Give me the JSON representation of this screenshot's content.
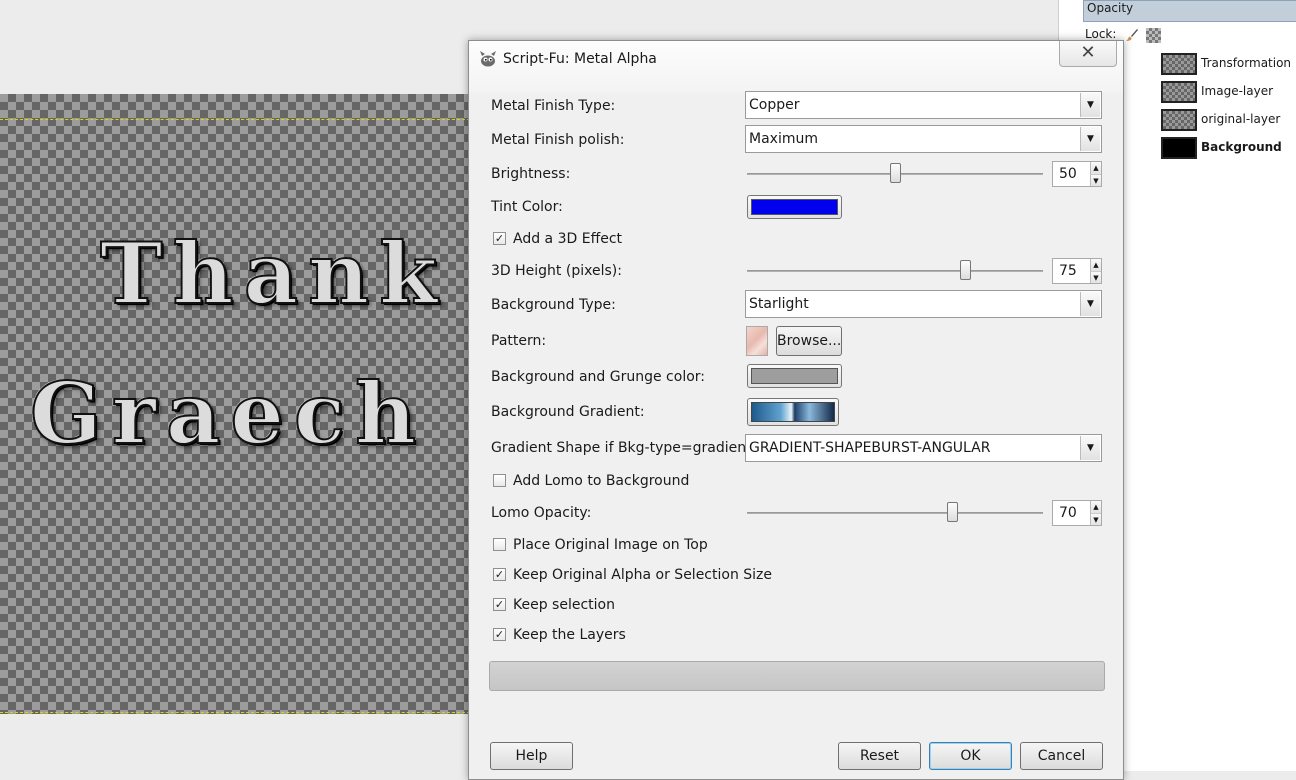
{
  "canvas": {
    "text_line1": "Thank",
    "text_line2": "Graech"
  },
  "layers_panel": {
    "opacity_label": "Opacity",
    "lock_label": "Lock:",
    "layers": [
      {
        "name": "Transformation"
      },
      {
        "name": "Image-layer"
      },
      {
        "name": "original-layer"
      },
      {
        "name": "Background"
      }
    ]
  },
  "dialog": {
    "title": "Script-Fu: Metal Alpha",
    "close_glyph": "✕",
    "fields": {
      "metal_finish_type": {
        "label": "Metal Finish Type:",
        "value": "Copper"
      },
      "metal_finish_polish": {
        "label": "Metal Finish polish:",
        "value": "Maximum"
      },
      "brightness": {
        "label": "Brightness:",
        "value": "50"
      },
      "tint_color": {
        "label": "Tint Color:",
        "color": "#0000ee"
      },
      "add_3d": {
        "label": "Add a 3D Effect",
        "checked": true
      },
      "height_3d": {
        "label": "3D Height (pixels):",
        "value": "75"
      },
      "background_type": {
        "label": "Background Type:",
        "value": "Starlight"
      },
      "pattern": {
        "label": "Pattern:",
        "browse_label": "Browse..."
      },
      "grunge_color": {
        "label": "Background and Grunge color:",
        "color": "#9e9e9e"
      },
      "background_gradient": {
        "label": "Background Gradient:"
      },
      "gradient_shape": {
        "label": "Gradient Shape if Bkg-type=gradient:",
        "value": "GRADIENT-SHAPEBURST-ANGULAR"
      },
      "add_lomo": {
        "label": "Add Lomo to Background",
        "checked": false
      },
      "lomo_opacity": {
        "label": "Lomo Opacity:",
        "value": "70"
      },
      "place_original": {
        "label": "Place Original Image on Top",
        "checked": false
      },
      "keep_alpha": {
        "label": "Keep Original Alpha or Selection Size",
        "checked": true
      },
      "keep_selection": {
        "label": "Keep selection",
        "checked": true
      },
      "keep_layers": {
        "label": "Keep the Layers",
        "checked": true
      }
    },
    "buttons": {
      "help": "Help",
      "reset": "Reset",
      "ok": "OK",
      "cancel": "Cancel"
    },
    "check_glyph": "✓",
    "dropdown_glyph": "▼",
    "spin_up_glyph": "▲",
    "spin_down_glyph": "▼"
  }
}
